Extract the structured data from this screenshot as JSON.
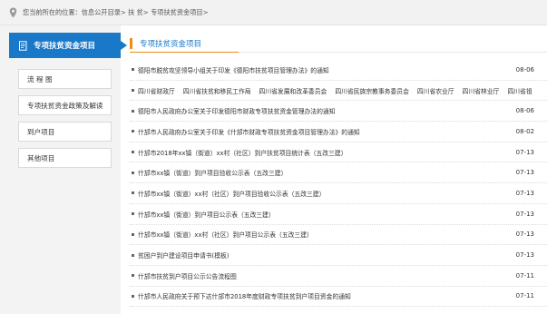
{
  "breadcrumb": {
    "text": "您当前所在的位置：信息公开目录> 扶 贫> 专项扶贫资金项目>"
  },
  "sidebar": {
    "header_label": "专项扶贫资金项目",
    "items": [
      {
        "label": "流 程 图"
      },
      {
        "label": "专项扶贫资金政策及解读"
      },
      {
        "label": "到户项目"
      },
      {
        "label": "其他项目"
      }
    ]
  },
  "main": {
    "title": "专项扶贫资金项目",
    "rows": [
      {
        "title": "德阳市脱贫攻坚领导小组关于印发《德阳市扶贫项目管理办法》的通知",
        "date": "08-06"
      },
      {
        "title": "德阳市人民政府办公室关于印发德阳市财政专项扶贫资金管理办法的通知",
        "date": "08-06"
      },
      {
        "title": "什邡市人民政府办公室关于印发《什邡市财政专项扶贫资金项目管理办法》的通知",
        "date": "08-02"
      },
      {
        "title": "什邡市2018年xx镇（街道）xx村（社区）到户扶贫项目统计表（五改三建）",
        "date": "07-13"
      },
      {
        "title": "什邡市xx镇（街道）到户项目验收公示表（五改三建）",
        "date": "07-13"
      },
      {
        "title": "什邡市xx镇（街道）xx村（社区）到户项目验收公示表（五改三建）",
        "date": "07-13"
      },
      {
        "title": "什邡市xx镇（街道）到户项目公示表（五改三建）",
        "date": "07-13"
      },
      {
        "title": "什邡市xx镇（街道）xx村（社区）到户项目公示表（五改三建）",
        "date": "07-13"
      },
      {
        "title": "贫困户到户建设项目申请书(模板)",
        "date": "07-13"
      },
      {
        "title": "什邡市扶贫到户项目公示公告流程图",
        "date": "07-11"
      },
      {
        "title": "什邡市人民政府关于预下达什邡市2018年度财政专项扶贫到户项目资金的通知",
        "date": "07-11"
      }
    ],
    "orgs": [
      "四川省财政厅",
      "四川省扶贫和移民工作局",
      "四川省发展和改革委员会",
      "四川省民族宗教事务委员会",
      "四川省农业厅",
      "四川省林业厅",
      "四川省祖"
    ]
  },
  "colors": {
    "accent_blue": "#1a78c9",
    "accent_orange": "#f08c1e"
  }
}
